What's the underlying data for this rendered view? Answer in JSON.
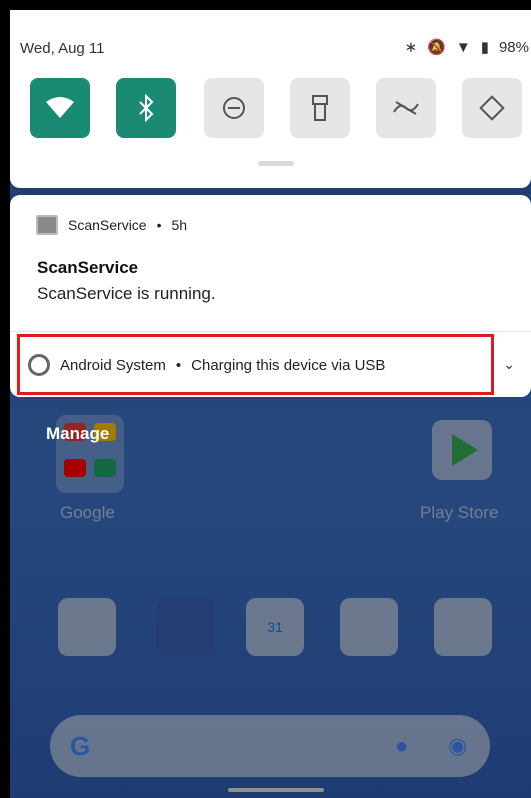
{
  "quick_settings": {
    "date": "Wed, Aug 11",
    "battery": "98%",
    "tiles": [
      {
        "name": "wifi",
        "state": "on",
        "icon": "wifi-icon"
      },
      {
        "name": "bluetooth",
        "state": "on",
        "icon": "bluetooth-icon"
      },
      {
        "name": "do-not-disturb",
        "state": "off",
        "icon": "dnd-icon"
      },
      {
        "name": "flashlight",
        "state": "off",
        "icon": "flashlight-icon"
      },
      {
        "name": "hotspot",
        "state": "off",
        "icon": "hotspot-icon"
      },
      {
        "name": "auto-rotate",
        "state": "off",
        "icon": "rotate-icon"
      }
    ],
    "accent": "#1b8a74"
  },
  "notifications": [
    {
      "app": "ScanService",
      "time": "5h",
      "title": "ScanService",
      "text": "ScanService is running."
    },
    {
      "app": "Android System",
      "summary": "Charging this device via USB"
    }
  ],
  "home": {
    "manage_label": "Manage",
    "labels": [
      "Google",
      "Play Store"
    ],
    "dock": [
      "phone-icon",
      "messages-icon",
      "calendar-icon",
      "contacts-icon",
      "camera-icon"
    ],
    "calendar_day": "31"
  },
  "highlight_color": "#e01b1b"
}
